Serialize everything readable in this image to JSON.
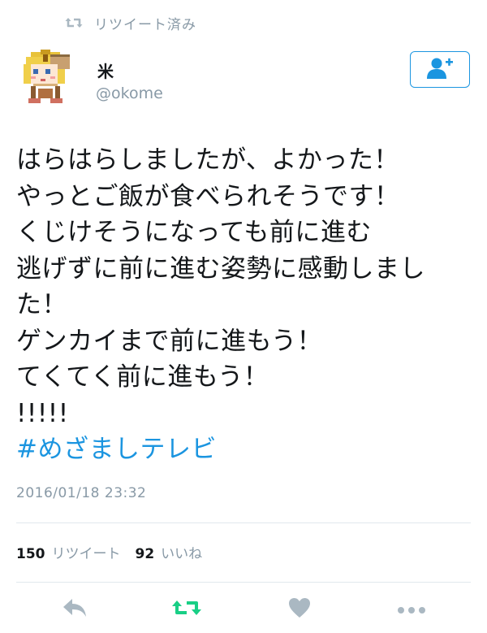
{
  "header": {
    "retweeted_label": "リツイート済み",
    "retweet_icon": "retweet-icon"
  },
  "user": {
    "name": "米",
    "handle": "@okome",
    "avatar": "pixel-character-avatar"
  },
  "follow_button": {
    "icon": "add-user-icon"
  },
  "tweet": {
    "lines": [
      "はらはらしましたが、よかった！",
      "やっとご飯が食べられそうです！",
      "くじけそうになっても前に進む",
      "逃げずに前に進む姿勢に感動しまし",
      "た！",
      "ゲンカイまで前に進もう！",
      "てくてく前に進もう！",
      "!!!!!"
    ],
    "hashtag": "#めざましテレビ",
    "timestamp": "2016/01/18 23:32"
  },
  "stats": {
    "retweet_count": "150",
    "retweet_label": "リツイート",
    "like_count": "92",
    "like_label": "いいね"
  },
  "actions": {
    "reply_icon": "reply-icon",
    "retweet_icon": "retweet-icon",
    "like_icon": "heart-icon",
    "more_icon": "more-icon"
  },
  "colors": {
    "accent": "#1b95e0",
    "retweet_green": "#19cf86",
    "muted": "#8899a6",
    "action_gray": "#aab8c2"
  }
}
